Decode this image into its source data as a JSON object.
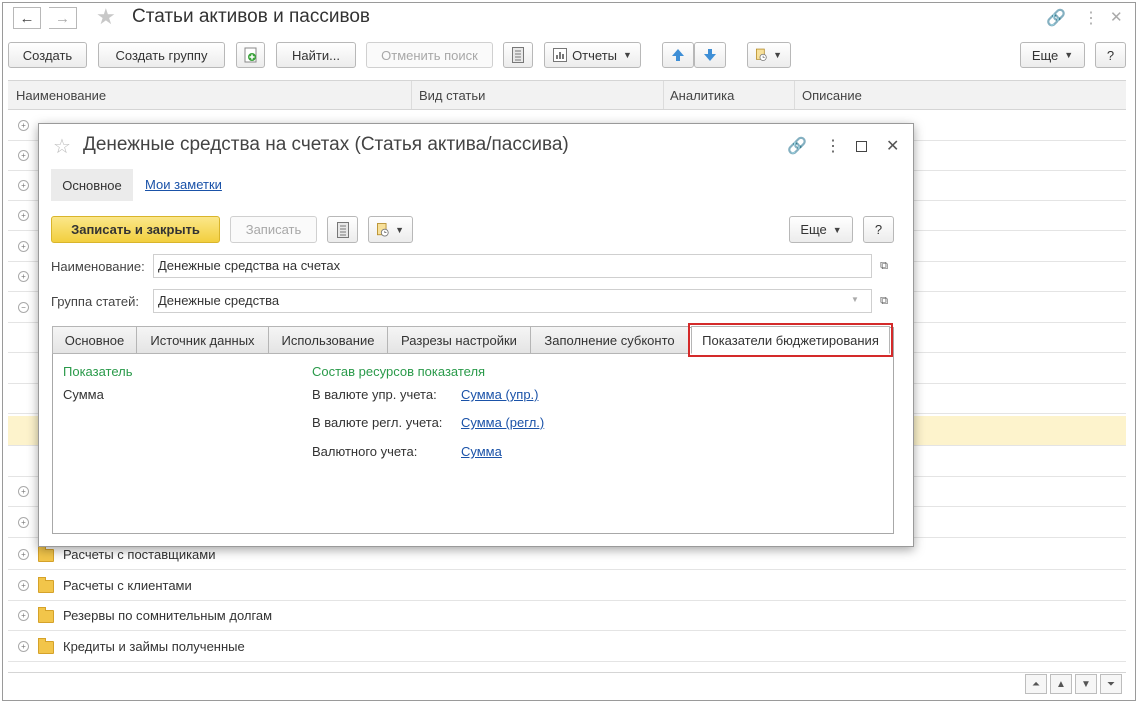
{
  "window": {
    "title": "Статьи активов и пассивов"
  },
  "toolbar": {
    "create": "Создать",
    "create_group": "Создать группу",
    "find": "Найти...",
    "cancel_search": "Отменить поиск",
    "reports": "Отчеты",
    "more": "Еще",
    "help": "?"
  },
  "grid": {
    "columns": [
      "Наименование",
      "Вид статьи",
      "Аналитика",
      "Описание"
    ],
    "visible_rows": [
      "Расчеты с поставщиками",
      "Расчеты с клиентами",
      "Резервы по сомнительным долгам",
      "Кредиты и займы полученные"
    ]
  },
  "dialog": {
    "title": "Денежные средства на счетах (Статья актива/пассива)",
    "top_tabs": [
      "Основное",
      "Мои заметки"
    ],
    "buttons": {
      "save_close": "Записать и закрыть",
      "save": "Записать",
      "more": "Еще",
      "help": "?"
    },
    "fields": {
      "name_label": "Наименование:",
      "name_value": "Денежные средства на счетах",
      "group_label": "Группа статей:",
      "group_value": "Денежные средства"
    },
    "tabs": [
      "Основное",
      "Источник данных",
      "Использование",
      "Разрезы настройки",
      "Заполнение субконто",
      "Показатели бюджетирования"
    ],
    "tab_content": {
      "indicator_header": "Показатель",
      "indicator_value": "Сумма",
      "resources_header": "Состав ресурсов показателя",
      "resources": [
        {
          "label": "В валюте упр. учета:",
          "value": "Сумма (упр.)"
        },
        {
          "label": "В валюте регл. учета:",
          "value": "Сумма (регл.)"
        },
        {
          "label": "Валютного учета:",
          "value": "Сумма"
        }
      ]
    }
  }
}
